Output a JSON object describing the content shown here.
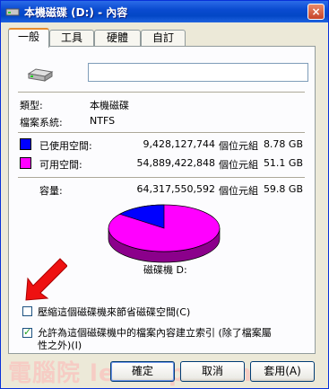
{
  "window": {
    "title": "本機磁碟 (D:) - 內容",
    "close_label": "×"
  },
  "tabs": [
    {
      "label": "一般",
      "active": true
    },
    {
      "label": "工具",
      "active": false
    },
    {
      "label": "硬體",
      "active": false
    },
    {
      "label": "自訂",
      "active": false
    }
  ],
  "general": {
    "name_value": "",
    "type_label": "類型:",
    "type_value": "本機磁碟",
    "fs_label": "檔案系統:",
    "fs_value": "NTFS",
    "used": {
      "label": "已使用空間:",
      "bytes": "9,428,127,744",
      "unit": "個位元組",
      "size": "8.78 GB",
      "color": "#0000ff"
    },
    "free": {
      "label": "可用空間:",
      "bytes": "54,889,422,848",
      "unit": "個位元組",
      "size": "51.1 GB",
      "color": "#ff00ff"
    },
    "capacity": {
      "label": "容量:",
      "bytes": "64,317,550,592",
      "unit": "個位元組",
      "size": "59.8 GB"
    },
    "used_fraction": 0.1466,
    "drive_label": "磁碟機 D:"
  },
  "options": {
    "compress_label": "壓縮這個磁碟機來節省磁碟空間(C)",
    "compress_checked": false,
    "index_label_line1": "允許為這個磁碟機中的檔案內容建立索引 (除了檔案屬",
    "index_label_line2": "性之外)(I)",
    "index_checked": true
  },
  "buttons": {
    "ok": "確定",
    "cancel": "取消",
    "apply": "套用(A)"
  },
  "watermark": "電腦院 letuisp.com"
}
